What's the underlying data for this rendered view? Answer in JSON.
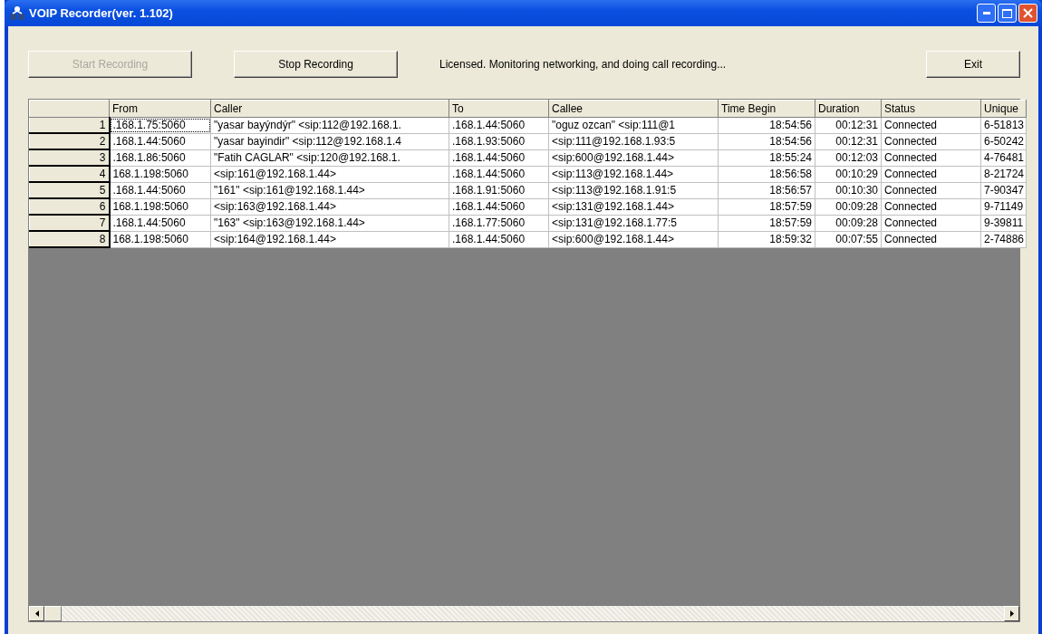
{
  "window": {
    "title": "VOIP Recorder(ver. 1.102)"
  },
  "toolbar": {
    "buttons": [
      {
        "label": "Start Recording",
        "disabled": true
      },
      {
        "label": "Stop Recording",
        "disabled": false
      }
    ],
    "status": "Licensed. Monitoring networking, and doing call recording...",
    "exit": "Exit"
  },
  "table": {
    "columns": [
      "From",
      "Caller",
      "To",
      "Callee",
      "Time Begin",
      "Duration",
      "Status",
      "Unique"
    ],
    "rows": [
      {
        "index": "1",
        "focused": true,
        "cells": [
          ".168.1.75:5060",
          "\"yasar bayýndýr\" <sip:112@192.168.1.",
          ".168.1.44:5060",
          "\"oguz ozcan\" <sip:111@1",
          "18:54:56",
          "00:12:31",
          "Connected",
          "6-51813"
        ]
      },
      {
        "index": "2",
        "focused": false,
        "cells": [
          ".168.1.44:5060",
          "\"yasar bayindir\" <sip:112@192.168.1.4",
          ".168.1.93:5060",
          "<sip:111@192.168.1.93:5",
          "18:54:56",
          "00:12:31",
          "Connected",
          "6-50242"
        ]
      },
      {
        "index": "3",
        "focused": false,
        "cells": [
          ".168.1.86:5060",
          "\"Fatih CAGLAR\" <sip:120@192.168.1.",
          ".168.1.44:5060",
          "<sip:600@192.168.1.44>",
          "18:55:24",
          "00:12:03",
          "Connected",
          "4-76481"
        ]
      },
      {
        "index": "4",
        "focused": false,
        "cells": [
          "168.1.198:5060",
          "<sip:161@192.168.1.44>",
          ".168.1.44:5060",
          "<sip:113@192.168.1.44>",
          "18:56:58",
          "00:10:29",
          "Connected",
          "8-21724"
        ]
      },
      {
        "index": "5",
        "focused": false,
        "cells": [
          ".168.1.44:5060",
          "\"161\" <sip:161@192.168.1.44>",
          ".168.1.91:5060",
          "<sip:113@192.168.1.91:5",
          "18:56:57",
          "00:10:30",
          "Connected",
          "7-90347"
        ]
      },
      {
        "index": "6",
        "focused": false,
        "cells": [
          "168.1.198:5060",
          "<sip:163@192.168.1.44>",
          ".168.1.44:5060",
          "<sip:131@192.168.1.44>",
          "18:57:59",
          "00:09:28",
          "Connected",
          "9-71149"
        ]
      },
      {
        "index": "7",
        "focused": false,
        "cells": [
          ".168.1.44:5060",
          "\"163\" <sip:163@192.168.1.44>",
          ".168.1.77:5060",
          "<sip:131@192.168.1.77:5",
          "18:57:59",
          "00:09:28",
          "Connected",
          "9-39811"
        ]
      },
      {
        "index": "8",
        "focused": false,
        "cells": [
          "168.1.198:5060",
          "<sip:164@192.168.1.44>",
          ".168.1.44:5060",
          "<sip:600@192.168.1.44>",
          "18:59:32",
          "00:07:55",
          "Connected",
          "2-74886"
        ]
      }
    ]
  }
}
